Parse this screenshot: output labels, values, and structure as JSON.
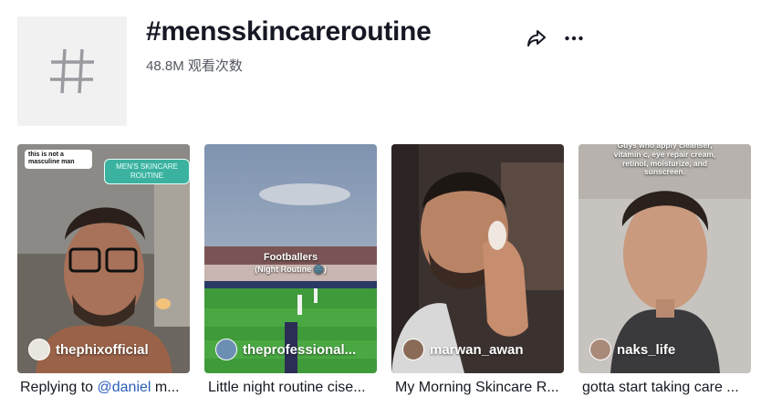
{
  "header": {
    "title": "#mensskincareroutine",
    "views": "48.8M 观看次数"
  },
  "icons": {
    "hashtag": "hashtag-icon",
    "share": "share-icon",
    "more": "more-icon"
  },
  "videos": [
    {
      "author": "thephixofficial",
      "caption_prefix": "Replying to ",
      "caption_mention": "@daniel",
      "caption_rest": " m...",
      "sticker_text": "this is not a masculine man",
      "bubble_text": "MEN'S SKINCARE ROUTINE"
    },
    {
      "author": "theprofessional...",
      "caption": "Little night routine cise...",
      "overlay_title": "Footballers",
      "overlay_sub": "(Night Routine 🌚)"
    },
    {
      "author": "marwan_awan",
      "caption": "My Morning Skincare R..."
    },
    {
      "author": "naks_life",
      "caption": "gotta start taking care ...",
      "overlay_text": "Guys who apply cleanser, vitamin c, eye repair cream, retinol, moisturize, and sunscreen."
    }
  ],
  "colors": {
    "text_primary": "#161823",
    "text_secondary": "#545761",
    "mention": "#2b5db9",
    "tile_bg": "#f1f1f2"
  }
}
